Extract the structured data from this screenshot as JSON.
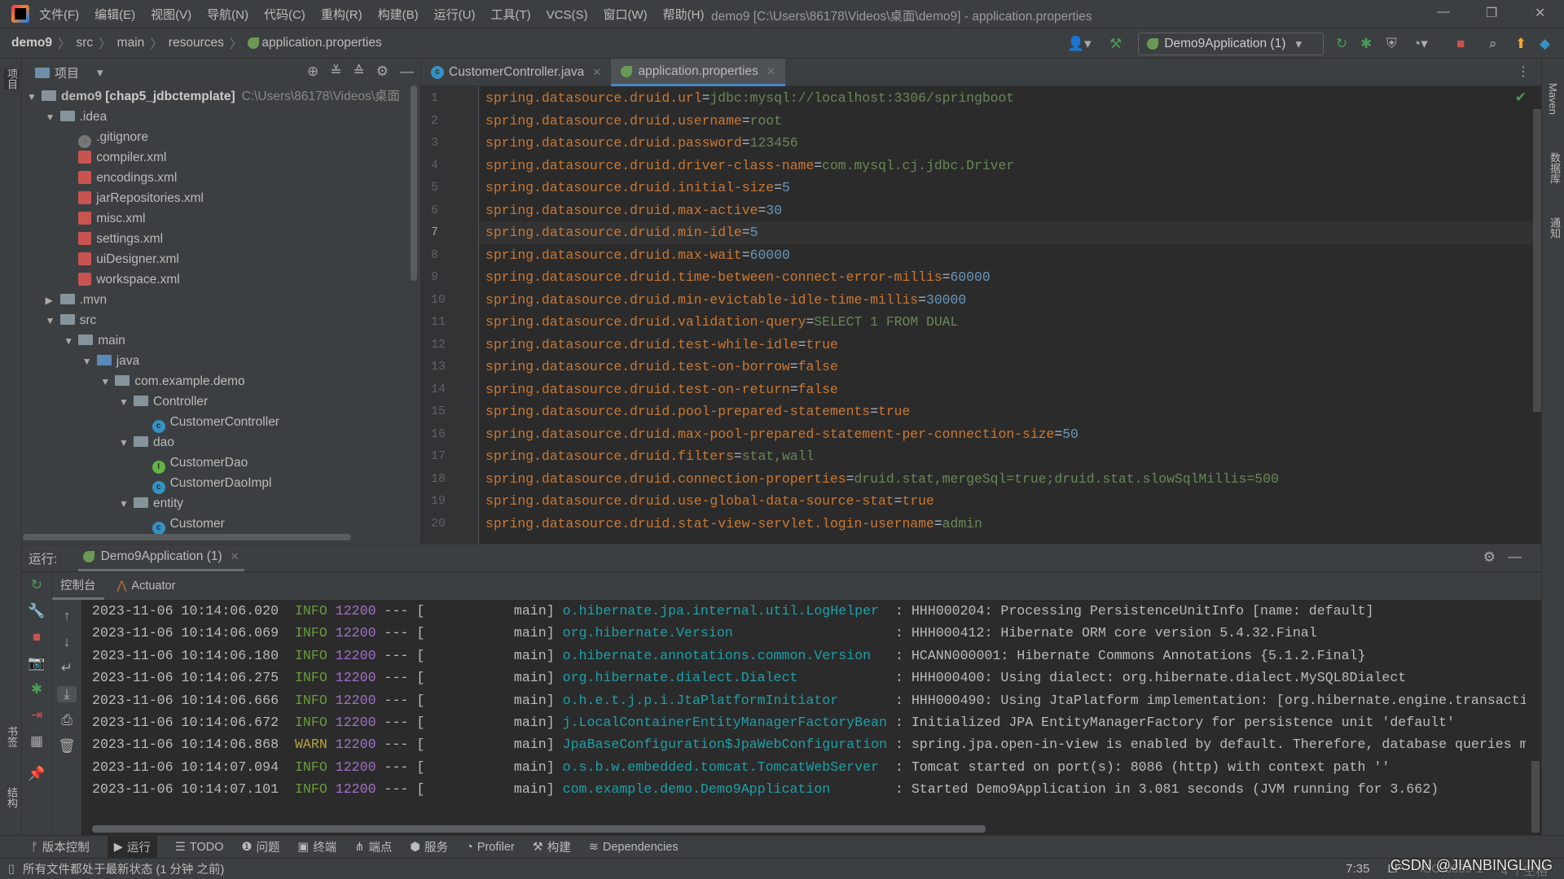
{
  "menu": [
    "文件(F)",
    "编辑(E)",
    "视图(V)",
    "导航(N)",
    "代码(C)",
    "重构(R)",
    "构建(B)",
    "运行(U)",
    "工具(T)",
    "VCS(S)",
    "窗口(W)",
    "帮助(H)"
  ],
  "window_title": "demo9 [C:\\Users\\86178\\Videos\\桌面\\demo9] - application.properties",
  "breadcrumb": [
    "demo9",
    "src",
    "main",
    "resources",
    "application.properties"
  ],
  "run_config": "Demo9Application (1)",
  "left_strip": {
    "project": "项目",
    "bookmarks": "书签",
    "structure": "结构"
  },
  "right_strip": {
    "maven": "Maven",
    "database": "数据库",
    "notifications": "通知"
  },
  "project": {
    "header": "项目",
    "tree": [
      {
        "level": 0,
        "type": "module",
        "label": "demo9",
        "bold": " [chap5_jdbctemplate]",
        "hint": "C:\\Users\\86178\\Videos\\桌面",
        "open": true
      },
      {
        "level": 1,
        "type": "folder",
        "label": ".idea",
        "open": true
      },
      {
        "level": 2,
        "type": "git",
        "label": ".gitignore"
      },
      {
        "level": 2,
        "type": "xml",
        "label": "compiler.xml"
      },
      {
        "level": 2,
        "type": "xml",
        "label": "encodings.xml"
      },
      {
        "level": 2,
        "type": "xml",
        "label": "jarRepositories.xml"
      },
      {
        "level": 2,
        "type": "xml",
        "label": "misc.xml"
      },
      {
        "level": 2,
        "type": "xml",
        "label": "settings.xml"
      },
      {
        "level": 2,
        "type": "xml",
        "label": "uiDesigner.xml"
      },
      {
        "level": 2,
        "type": "xml",
        "label": "workspace.xml"
      },
      {
        "level": 1,
        "type": "folder",
        "label": ".mvn",
        "open": false
      },
      {
        "level": 1,
        "type": "folder",
        "label": "src",
        "open": true
      },
      {
        "level": 2,
        "type": "folder",
        "label": "main",
        "open": true
      },
      {
        "level": 3,
        "type": "srcfolder",
        "label": "java",
        "open": true
      },
      {
        "level": 4,
        "type": "package",
        "label": "com.example.demo",
        "open": true
      },
      {
        "level": 5,
        "type": "package",
        "label": "Controller",
        "open": true
      },
      {
        "level": 6,
        "type": "class",
        "label": "CustomerController"
      },
      {
        "level": 5,
        "type": "package",
        "label": "dao",
        "open": true
      },
      {
        "level": 6,
        "type": "interface",
        "label": "CustomerDao"
      },
      {
        "level": 6,
        "type": "class",
        "label": "CustomerDaoImpl"
      },
      {
        "level": 5,
        "type": "package",
        "label": "entity",
        "open": true
      },
      {
        "level": 6,
        "type": "class",
        "label": "Customer"
      }
    ]
  },
  "editor": {
    "tabs": [
      {
        "label": "CustomerController.java",
        "active": false
      },
      {
        "label": "application.properties",
        "active": true
      }
    ],
    "current_line": 7,
    "lines": [
      [
        "spring.datasource.druid.url",
        "jdbc:mysql://localhost:3306/springboot",
        "v"
      ],
      [
        "spring.datasource.druid.username",
        "root",
        "v"
      ],
      [
        "spring.datasource.druid.password",
        "123456",
        "v"
      ],
      [
        "spring.datasource.druid.driver-class-name",
        "com.mysql.cj.jdbc.Driver",
        "v"
      ],
      [
        "spring.datasource.druid.initial-size",
        "5",
        "n"
      ],
      [
        "spring.datasource.druid.max-active",
        "30",
        "n"
      ],
      [
        "spring.datasource.druid.min-idle",
        "5",
        "n"
      ],
      [
        "spring.datasource.druid.max-wait",
        "60000",
        "n"
      ],
      [
        "spring.datasource.druid.time-between-connect-error-millis",
        "60000",
        "n"
      ],
      [
        "spring.datasource.druid.min-evictable-idle-time-millis",
        "30000",
        "n"
      ],
      [
        "spring.datasource.druid.validation-query",
        "SELECT 1 FROM DUAL",
        "v"
      ],
      [
        "spring.datasource.druid.test-while-idle",
        "true",
        "k"
      ],
      [
        "spring.datasource.druid.test-on-borrow",
        "false",
        "k"
      ],
      [
        "spring.datasource.druid.test-on-return",
        "false",
        "k"
      ],
      [
        "spring.datasource.druid.pool-prepared-statements",
        "true",
        "k"
      ],
      [
        "spring.datasource.druid.max-pool-prepared-statement-per-connection-size",
        "50",
        "n"
      ],
      [
        "spring.datasource.druid.filters",
        "stat,wall",
        "v"
      ],
      [
        "spring.datasource.druid.connection-properties",
        "druid.stat,mergeSql=true;druid.stat.slowSqlMillis=500",
        "v"
      ],
      [
        "spring.datasource.druid.use-global-data-source-stat",
        "true",
        "k"
      ],
      [
        "spring.datasource.druid.stat-view-servlet.login-username",
        "admin",
        "v"
      ]
    ]
  },
  "run": {
    "label": "运行:",
    "tab": "Demo9Application (1)",
    "console_tab": "控制台",
    "actuator_tab": "Actuator",
    "log": [
      [
        "2023-11-06 10:14:06.020",
        "INFO",
        "12200",
        "main",
        "o.hibernate.jpa.internal.util.LogHelper",
        "HHH000204: Processing PersistenceUnitInfo [name: default]"
      ],
      [
        "2023-11-06 10:14:06.069",
        "INFO",
        "12200",
        "main",
        "org.hibernate.Version",
        "HHH000412: Hibernate ORM core version 5.4.32.Final"
      ],
      [
        "2023-11-06 10:14:06.180",
        "INFO",
        "12200",
        "main",
        "o.hibernate.annotations.common.Version",
        "HCANN000001: Hibernate Commons Annotations {5.1.2.Final}"
      ],
      [
        "2023-11-06 10:14:06.275",
        "INFO",
        "12200",
        "main",
        "org.hibernate.dialect.Dialect",
        "HHH000400: Using dialect: org.hibernate.dialect.MySQL8Dialect"
      ],
      [
        "2023-11-06 10:14:06.666",
        "INFO",
        "12200",
        "main",
        "o.h.e.t.j.p.i.JtaPlatformInitiator",
        "HHH000490: Using JtaPlatform implementation: [org.hibernate.engine.transactio"
      ],
      [
        "2023-11-06 10:14:06.672",
        "INFO",
        "12200",
        "main",
        "j.LocalContainerEntityManagerFactoryBean",
        "Initialized JPA EntityManagerFactory for persistence unit 'default'"
      ],
      [
        "2023-11-06 10:14:06.868",
        "WARN",
        "12200",
        "main",
        "JpaBaseConfiguration$JpaWebConfiguration",
        "spring.jpa.open-in-view is enabled by default. Therefore, database queries ma"
      ],
      [
        "2023-11-06 10:14:07.094",
        "INFO",
        "12200",
        "main",
        "o.s.b.w.embedded.tomcat.TomcatWebServer",
        "Tomcat started on port(s): 8086 (http) with context path ''"
      ],
      [
        "2023-11-06 10:14:07.101",
        "INFO",
        "12200",
        "main",
        "com.example.demo.Demo9Application",
        "Started Demo9Application in 3.081 seconds (JVM running for 3.662)"
      ]
    ]
  },
  "tool_tabs": [
    {
      "label": "版本控制",
      "icon": "vcs-icon"
    },
    {
      "label": "运行",
      "icon": "run-icon",
      "active": true
    },
    {
      "label": "TODO",
      "icon": "list-icon"
    },
    {
      "label": "问题",
      "icon": "problems-icon"
    },
    {
      "label": "终端",
      "icon": "terminal-icon"
    },
    {
      "label": "端点",
      "icon": "endpoints-icon"
    },
    {
      "label": "服务",
      "icon": "services-icon"
    },
    {
      "label": "Profiler",
      "icon": "profiler-icon"
    },
    {
      "label": "构建",
      "icon": "build-icon"
    },
    {
      "label": "Dependencies",
      "icon": "dependencies-icon"
    }
  ],
  "status": {
    "message": "所有文件都处于最新状态 (1 分钟 之前)",
    "position": "7:35",
    "line_sep": "LF",
    "encoding": "ISO-8859-1",
    "indent": "4 个空格",
    "watermark": "CSDN @JIANBINGLING"
  },
  "colors": {
    "key": "#cc7832",
    "string": "#6a8759",
    "number": "#6897bb",
    "accent": "#4a88c7"
  }
}
